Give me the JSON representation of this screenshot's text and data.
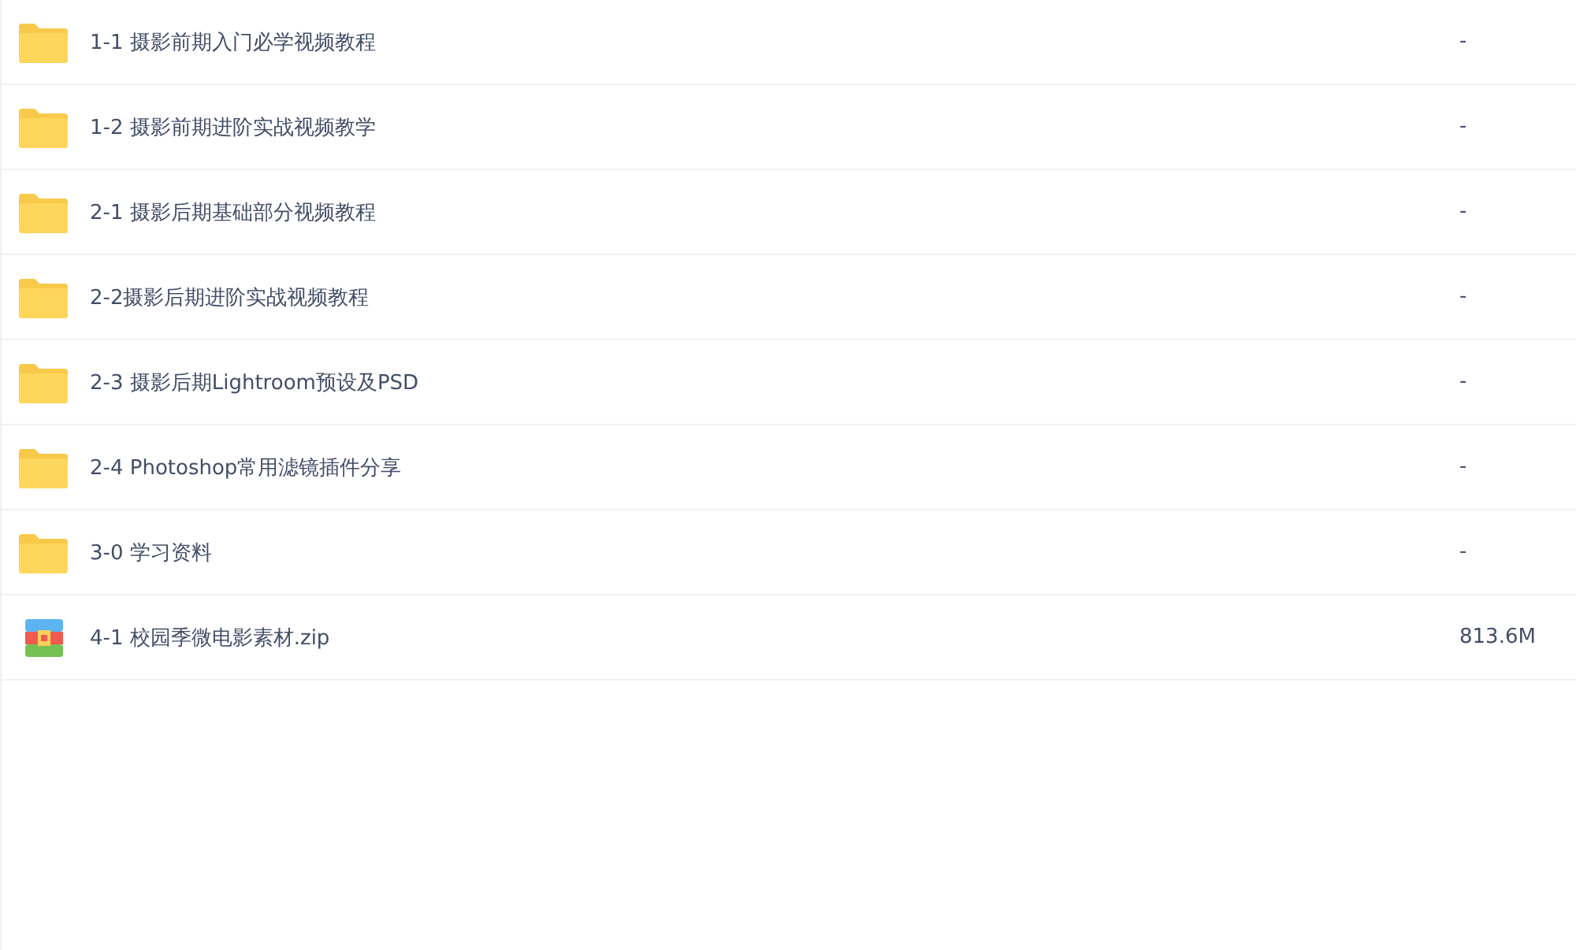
{
  "files": [
    {
      "kind": "folder",
      "name": "1-1 摄影前期入门必学视频教程",
      "size": "-"
    },
    {
      "kind": "folder",
      "name": "1-2 摄影前期进阶实战视频教学",
      "size": "-"
    },
    {
      "kind": "folder",
      "name": "2-1 摄影后期基础部分视频教程",
      "size": "-"
    },
    {
      "kind": "folder",
      "name": "2-2摄影后期进阶实战视频教程",
      "size": "-"
    },
    {
      "kind": "folder",
      "name": "2-3 摄影后期Lightroom预设及PSD",
      "size": "-"
    },
    {
      "kind": "folder",
      "name": "2-4 Photoshop常用滤镜插件分享",
      "size": "-"
    },
    {
      "kind": "folder",
      "name": "3-0 学习资料",
      "size": "-"
    },
    {
      "kind": "zip",
      "name": "4-1 校园季微电影素材.zip",
      "size": "813.6M"
    }
  ]
}
